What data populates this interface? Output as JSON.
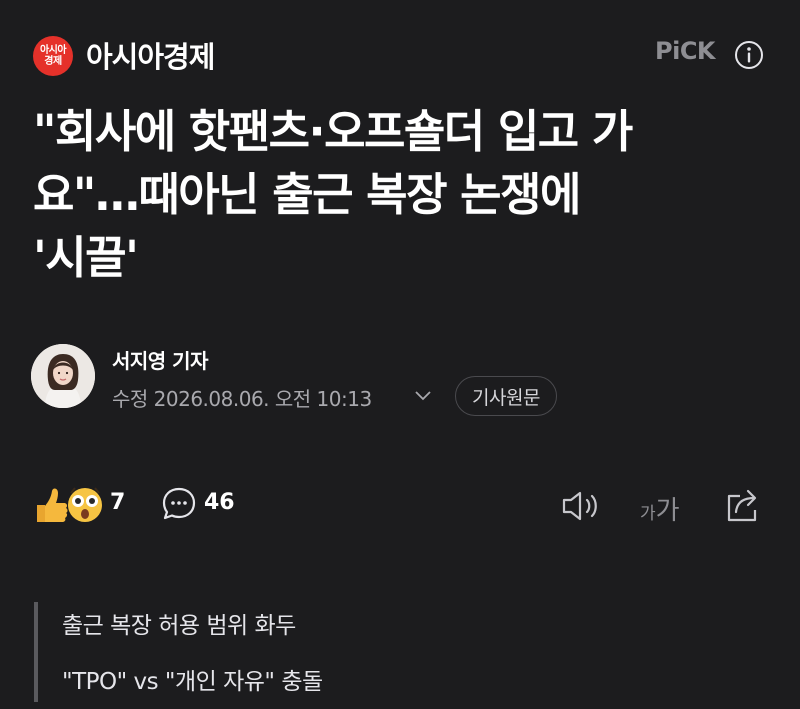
{
  "header": {
    "logo_line1": "아시아",
    "logo_line2": "경제",
    "press_name": "아시아경제",
    "pick_label": "PiCK",
    "icons": {
      "info": "info-circle-icon"
    }
  },
  "article": {
    "title_line1": "\"회사에 핫팬츠·오프숄더 입고 가",
    "title_line2": "요\"…때아닌 출근 복장 논쟁에",
    "title_line3": "'시끌'"
  },
  "reporter": {
    "name": "서지영 기자",
    "dateline": "수정 2026.08.06. 오전 10:13",
    "original_button": "기사원문",
    "icons": {
      "avatar": "reporter-photo",
      "chevron": "chevron-down-icon"
    }
  },
  "actions": {
    "reaction_count": "7",
    "comment_count": "46",
    "fontsize_small": "가",
    "fontsize_big": "가",
    "icons": {
      "reactions": "thumbs-up-and-surprised-emoji-icon",
      "comment": "speech-bubble-icon",
      "listen": "speaker-icon",
      "share": "share-icon"
    },
    "colors": {
      "thumb": "#f5b83d",
      "surprised": "#f6c443"
    }
  },
  "summary": {
    "line1": "출근 복장 허용 범위 화두",
    "line2": "\"TPO\" vs \"개인 자유\" 충돌"
  },
  "colors": {
    "background": "#1c1c1e",
    "logo_red": "#e5312a",
    "muted_text": "#a9a9ae"
  }
}
